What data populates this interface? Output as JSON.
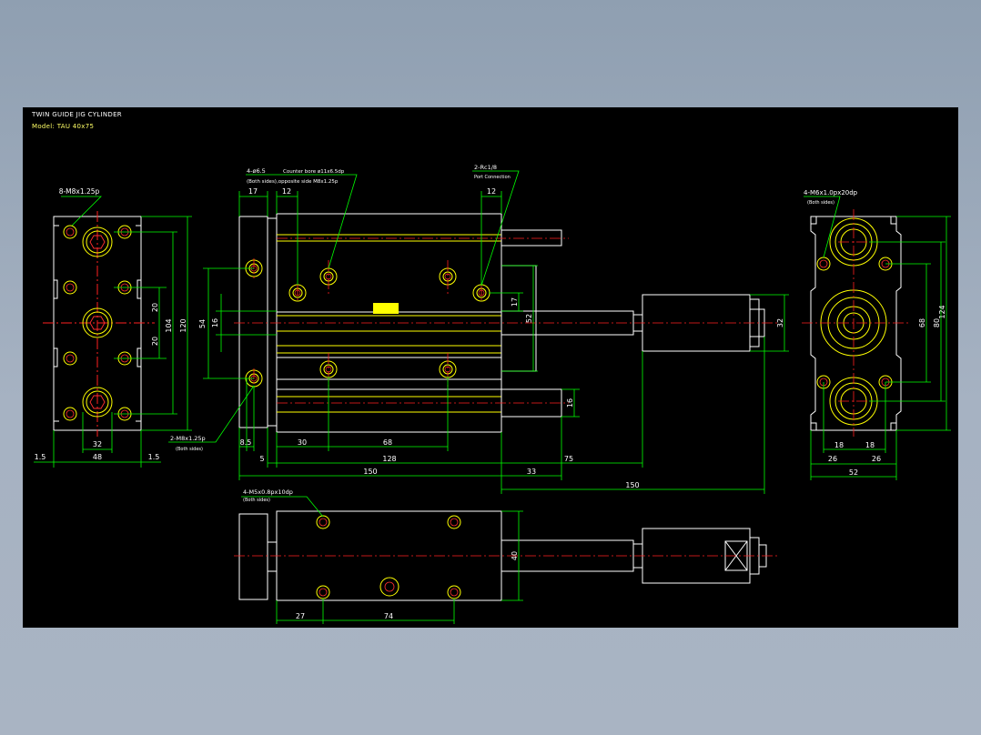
{
  "header": {
    "title": "TWIN GUIDE JIG CYLINDER",
    "model": "Model: TAU 40x75"
  },
  "colors": {
    "background": "#000000",
    "outline": "#ffffff",
    "hole": "#ffff00",
    "centerline": "#ff2020",
    "dimension": "#00ff00",
    "window_frame": "#9aa8b8"
  },
  "callouts": {
    "thru_holes": "4-ø6.5",
    "counter_bore": "Counter bore ø11x6.5dp",
    "both_sides_opp": "(Both sides),opposite side M8x1.25p",
    "port": "2-Rc1/8",
    "port_sub": "Port Connection",
    "end_left_taps": "8-M8x1.25p",
    "plate_taps": "2-M8x1.25p",
    "plate_taps_sub": "(Both sides)",
    "end_right_taps": "4-M6x1.0px20dp",
    "end_right_taps_sub": "(Both sides)",
    "bottom_taps": "4-M5x0.8px10dp",
    "bottom_taps_sub": "(Both sides)"
  },
  "dimensions": {
    "left_end": {
      "d20a": "20",
      "d20b": "20",
      "d104": "104",
      "d120": "120",
      "d32": "32",
      "d48": "48",
      "d1_5a": "1.5",
      "d1_5b": "1.5"
    },
    "front": {
      "d17": "17",
      "d12a": "12",
      "d12b": "12",
      "d54": "54",
      "d16a": "16",
      "d17b": "17",
      "d52": "52",
      "d16b": "16",
      "d32": "32",
      "d8_5": "8.5",
      "d30": "30",
      "d68": "68",
      "d128": "128",
      "d5": "5",
      "d75": "75",
      "d150a": "150",
      "d33": "33",
      "d150b": "150"
    },
    "right_end": {
      "d68": "68",
      "d80": "80",
      "d124": "124",
      "d18a": "18",
      "d18b": "18",
      "d26a": "26",
      "d26b": "26",
      "d52": "52"
    },
    "bottom": {
      "d40": "40",
      "d27": "27",
      "d74": "74"
    }
  }
}
